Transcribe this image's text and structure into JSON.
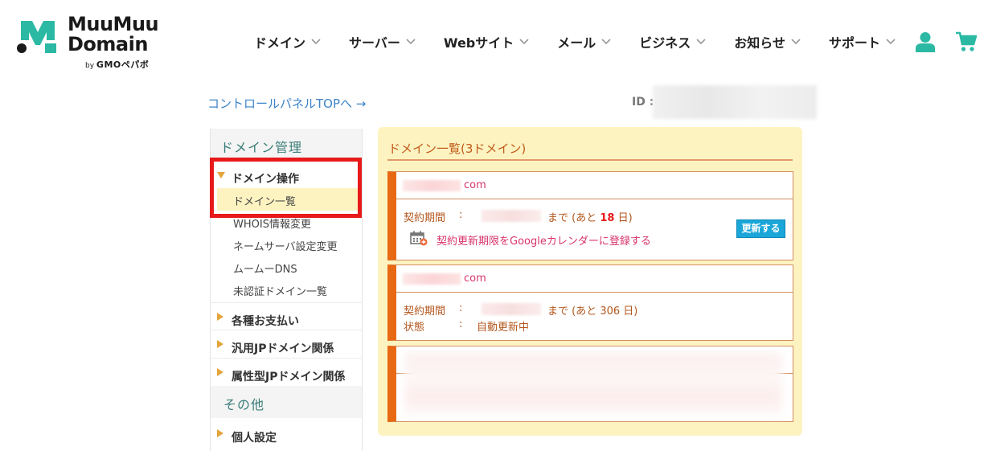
{
  "brand": {
    "line1": "MuuMuu",
    "line2": "Domain",
    "by": "by",
    "company": "GMO",
    "company_jp": "ペパボ",
    "mark_color": "#2bb9a4"
  },
  "nav": {
    "items": [
      {
        "label": "ドメイン"
      },
      {
        "label": "サーバー"
      },
      {
        "label": "Webサイト"
      },
      {
        "label": "メール"
      },
      {
        "label": "ビジネス"
      },
      {
        "label": "お知らせ"
      },
      {
        "label": "サポート"
      }
    ],
    "user_icon": "user-icon",
    "cart_icon": "cart-icon",
    "icon_color": "#2bb9a4"
  },
  "topbar": {
    "control_panel_link": "コントロールパネルTOPへ →",
    "id_label": "ID :"
  },
  "sidebar": {
    "section1": "ドメイン管理",
    "group_domain_ops": "ドメイン操作",
    "sub_items": [
      {
        "label": "ドメイン一覧"
      },
      {
        "label": "WHOIS情報変更"
      },
      {
        "label": "ネームサーバ設定変更"
      },
      {
        "label": "ムームーDNS"
      },
      {
        "label": "未認証ドメイン一覧"
      }
    ],
    "groups": [
      {
        "label": "各種お支払い"
      },
      {
        "label": "汎用JPドメイン関係"
      },
      {
        "label": "属性型JPドメイン関係"
      }
    ],
    "section2": "その他",
    "group_personal": "個人設定",
    "highlight_color": "#e8191a"
  },
  "main": {
    "title": "ドメイン一覧(3ドメイン)",
    "cards": [
      {
        "domain_suffix": "com",
        "period_label": "契約期間",
        "colon": ":",
        "until": "まで (あと",
        "days": "18",
        "days_unit": "日)",
        "renew_button": "更新する",
        "calendar_link": "契約更新期限をGoogleカレンダーに登録する"
      },
      {
        "domain_suffix": "com",
        "period_label": "契約期間",
        "colon": ":",
        "until": "まで (あと 306 日)",
        "status_label": "状態",
        "status_value": "自動更新中"
      }
    ]
  },
  "colors": {
    "accent_orange": "#e86913",
    "panel_bg": "#fdf3c1",
    "link_blue": "#3d84c9",
    "domain_pink": "#d8336b"
  }
}
